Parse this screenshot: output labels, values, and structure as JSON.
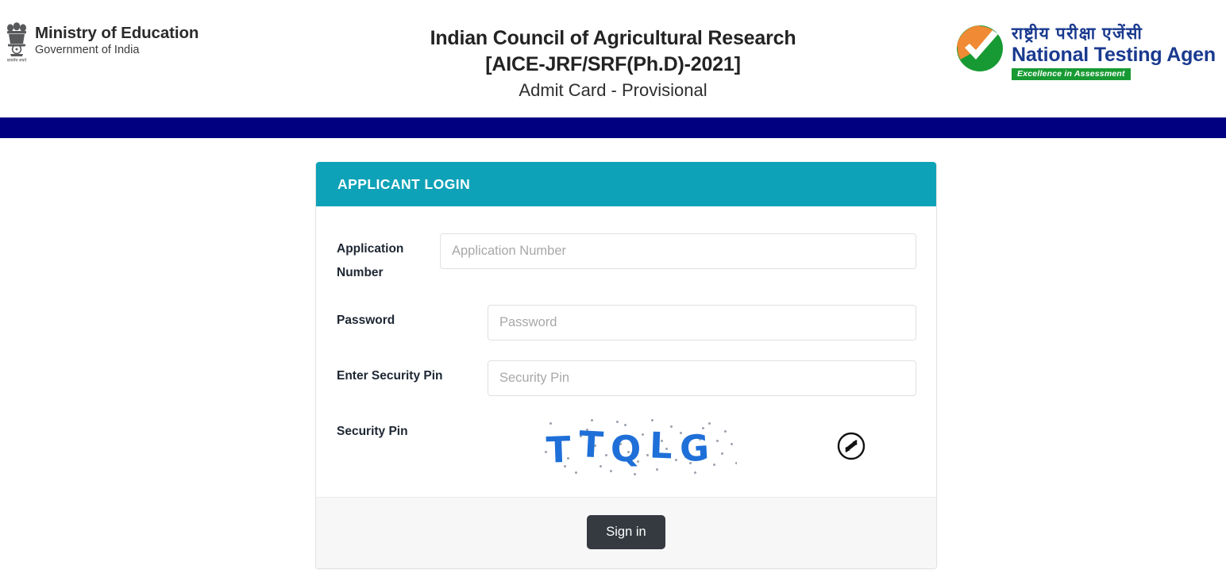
{
  "header": {
    "ministry": {
      "emblem_icon": "ashoka-emblem-icon",
      "line1": "Ministry of Education",
      "line2": "Government of India"
    },
    "title": {
      "line1": "Indian Council of Agricultural Research",
      "line2": "[AICE-JRF/SRF(Ph.D)-2021]",
      "line3": "Admit Card - Provisional"
    },
    "nta": {
      "mark_icon": "nta-checkmark-logo-icon",
      "hindi": "राष्ट्रीय परीक्षा एजेंसी",
      "english": "National Testing Agen",
      "tagline": "Excellence in Assessment"
    }
  },
  "colors": {
    "navy_bar": "#000080",
    "panel_header_teal": "#0ea2b8",
    "signin_button": "#343a40",
    "captcha_text": "#1f6fd8",
    "nta_blue": "#1a3a8f",
    "nta_green": "#179a33",
    "nta_orange": "#f08a34"
  },
  "login": {
    "panel_title": "APPLICANT LOGIN",
    "fields": [
      {
        "label": "Application Number",
        "placeholder": "Application Number",
        "value": "",
        "type": "text"
      },
      {
        "label": "Password",
        "placeholder": "Password",
        "value": "",
        "type": "password"
      },
      {
        "label": "Enter Security Pin",
        "placeholder": "Security Pin",
        "value": "",
        "type": "text"
      }
    ],
    "captcha": {
      "label": "Security Pin",
      "text": "TTQLG",
      "refresh_icon": "refresh-circle-icon"
    },
    "submit_label": "Sign in"
  }
}
